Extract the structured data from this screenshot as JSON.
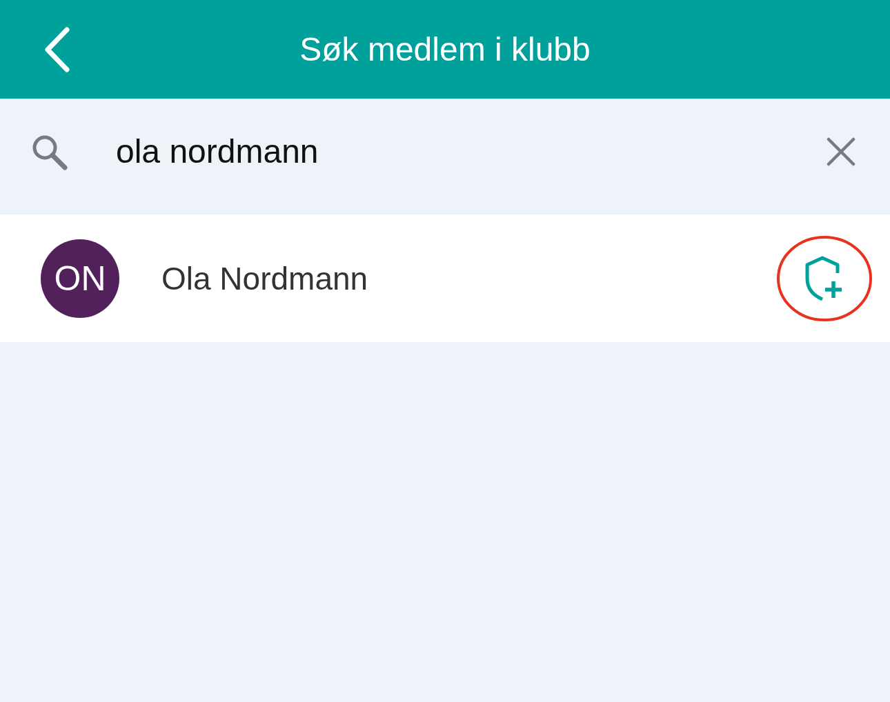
{
  "header": {
    "title": "Søk medlem i klubb"
  },
  "search": {
    "value": "ola nordmann"
  },
  "results": [
    {
      "initials": "ON",
      "name": "Ola Nordmann",
      "color": "#52205a",
      "highlighted": true
    }
  ]
}
